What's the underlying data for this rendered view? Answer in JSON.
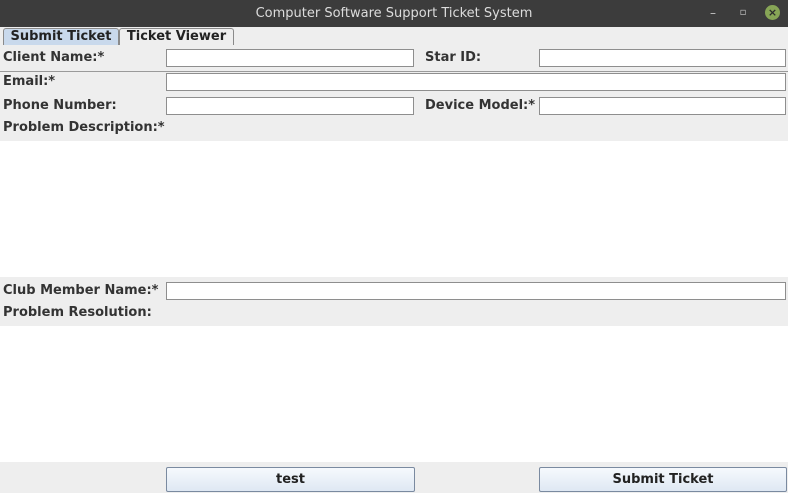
{
  "window": {
    "title": "Computer Software Support Ticket System",
    "minimize": "–",
    "maximize": "▫",
    "close": "×"
  },
  "tabs": [
    {
      "label": "Submit Ticket",
      "active": true
    },
    {
      "label": "Ticket Viewer",
      "active": false
    }
  ],
  "form": {
    "client_name_label": "Client Name:*",
    "client_name_value": "",
    "star_id_label": "Star ID:",
    "star_id_value": "",
    "email_label": "Email:*",
    "email_value": "",
    "phone_label": "Phone Number:",
    "phone_value": "",
    "device_model_label": "Device Model:*",
    "device_model_value": "",
    "problem_description_label": "Problem Description:*",
    "problem_description_value": "",
    "club_member_label": "Club Member Name:*",
    "club_member_value": "",
    "problem_resolution_label": "Problem Resolution:",
    "problem_resolution_value": ""
  },
  "buttons": {
    "test_label": "test",
    "submit_label": "Submit Ticket"
  }
}
